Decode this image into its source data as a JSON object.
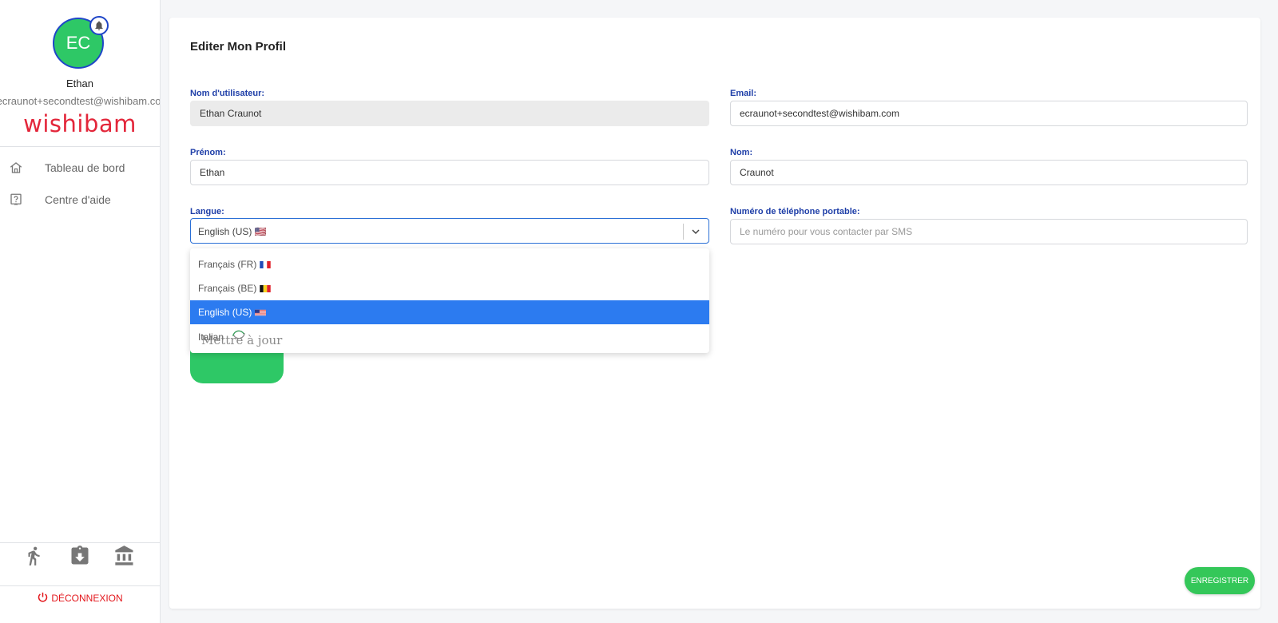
{
  "sidebar": {
    "avatar_initials": "EC",
    "user_name": "Ethan",
    "user_email": "ecraunot+secondtest@wishibam.com",
    "logo_text": "wishibam",
    "nav": [
      {
        "label": "Tableau de bord",
        "icon": "home-icon"
      },
      {
        "label": "Centre d'aide",
        "icon": "help-icon"
      }
    ],
    "bottom_icons": [
      "running-person-icon",
      "clipboard-download-icon",
      "bank-icon"
    ],
    "logout_label": "DÉCONNEXION",
    "accent_color": "#e3263a"
  },
  "form": {
    "title": "Editer Mon Profil",
    "username_label": "Nom d'utilisateur:",
    "username_value": "Ethan Craunot",
    "email_label": "Email:",
    "email_value": "ecraunot+secondtest@wishibam.com",
    "firstname_label": "Prénom:",
    "firstname_value": "Ethan",
    "lastname_label": "Nom:",
    "lastname_value": "Craunot",
    "language_label": "Langue:",
    "language_value": "English (US) 🇺🇸",
    "phone_label": "Numéro de téléphone portable:",
    "phone_placeholder": "Le numéro pour vous contacter par SMS",
    "language_options": [
      {
        "label": "Français (FR)",
        "flag": "fr",
        "selected": false
      },
      {
        "label": "Français (BE)",
        "flag": "be",
        "selected": false
      },
      {
        "label": "English (US)",
        "flag": "us",
        "selected": true
      },
      {
        "label": "Italian",
        "flag": "it",
        "selected": false
      }
    ],
    "update_button_label": "Mettre à jour",
    "save_button_label": "ENREGISTRER",
    "primary_green": "#2ec866",
    "select_blue": "#2c7bf0"
  }
}
